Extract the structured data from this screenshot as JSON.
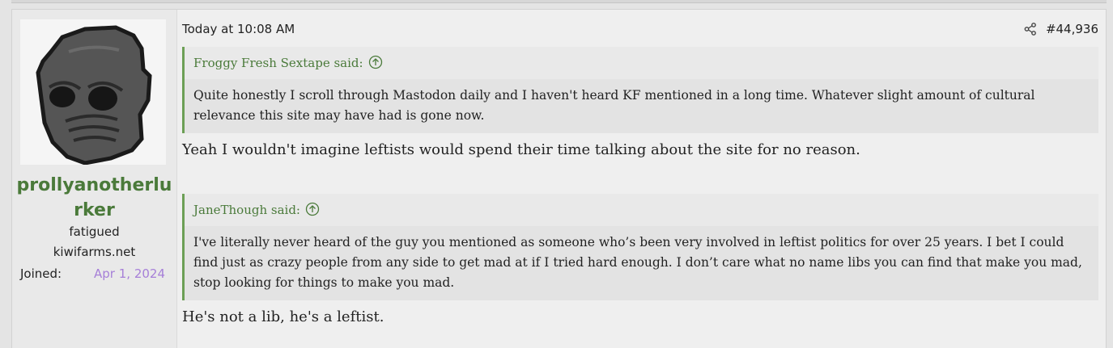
{
  "post": {
    "timestamp": "Today at 10:08 AM",
    "post_number": "#44,936",
    "share_icon": "share-icon"
  },
  "user": {
    "username_line1": "prollyanotherlu",
    "username_line2": "rker",
    "title": "fatigued",
    "site": "kiwifarms.net",
    "joined_label": "Joined:",
    "joined_date": "Apr 1, 2024",
    "avatar_icon": "gray-face-avatar"
  },
  "quotes": [
    {
      "author_text": "Froggy Fresh Sextape said:",
      "lines": [
        "Quite honestly I scroll through Mastodon daily and I haven't heard KF mentioned in a long time. Whatever slight amount of cultural",
        "relevance this site may have had is gone now."
      ]
    },
    {
      "author_text": "JaneThough said:",
      "lines": [
        "I've literally never heard of the guy you mentioned as someone who’s been very involved in leftist politics for over 25 years. I bet I could",
        "find just as crazy people from any side to get mad at if I tried hard enough. I don’t care what no name libs you can find that make you mad,",
        "stop looking for things to make you mad."
      ]
    }
  ],
  "replies": [
    "Yeah I wouldn't imagine leftists would spend their time talking about the site for no reason.",
    "He's not a lib, he's a leftist."
  ],
  "colors": {
    "accent_green": "#4a7a3a",
    "quote_bar": "#6c9f55",
    "joined_date": "#a67fd8"
  }
}
